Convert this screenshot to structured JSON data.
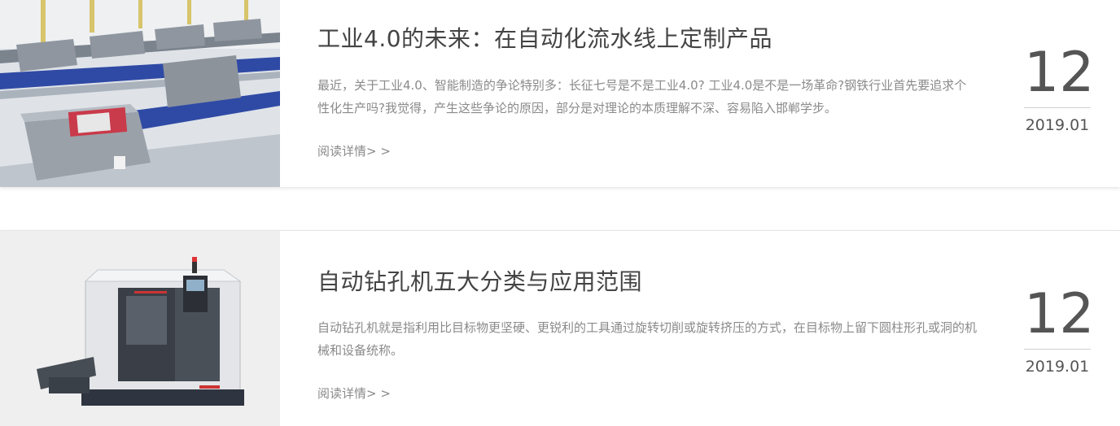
{
  "articles": [
    {
      "title": "工业4.0的未来：在自动化流水线上定制产品",
      "summary": "最近，关于工业4.0、智能制造的争论特别多：长征七号是不是工业4.0? 工业4.0是不是一场革命?钢铁行业首先要追求个性化生产吗?我觉得，产生这些争论的原因，部分是对理论的本质理解不深、容易陷入邯郸学步。",
      "read_more": "阅读详情> >",
      "day": "12",
      "year_month": "2019.01",
      "image_icon": "conveyor-line-photo"
    },
    {
      "title": "自动钻孔机五大分类与应用范围",
      "summary": "自动钻孔机就是指利用比目标物更坚硬、更锐利的工具通过旋转切削或旋转挤压的方式，在目标物上留下圆柱形孔或洞的机械和设备统称。",
      "read_more": "阅读详情> >",
      "day": "12",
      "year_month": "2019.01",
      "image_icon": "cnc-drilling-machine-photo"
    }
  ]
}
